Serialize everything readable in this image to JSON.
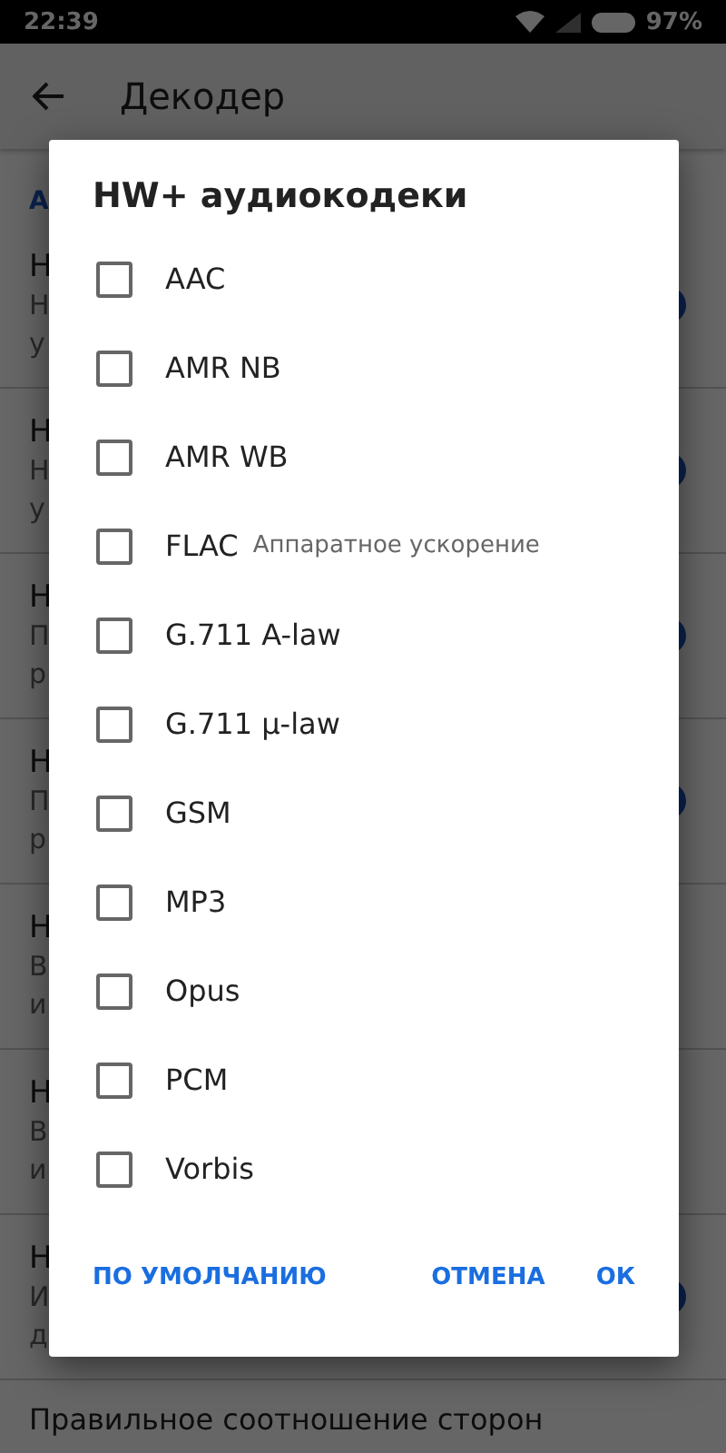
{
  "status_bar": {
    "time": "22:39",
    "battery": "97%"
  },
  "app_bar": {
    "title": "Декодер"
  },
  "section_header": "А",
  "settings_rows": [
    {
      "title": "Н",
      "lines": [
        "Н",
        "у"
      ],
      "on": true
    },
    {
      "title": "Н",
      "lines": [
        "Н",
        "у"
      ],
      "on": true
    },
    {
      "title": "Н",
      "lines": [
        "П",
        "р"
      ],
      "on": true
    },
    {
      "title": "Н",
      "lines": [
        "П",
        "р"
      ],
      "on": true
    },
    {
      "title": "Н",
      "lines": [
        "В",
        "и"
      ],
      "on": false
    },
    {
      "title": "Н",
      "lines": [
        "В",
        "и"
      ],
      "on": false
    },
    {
      "title": "Н",
      "lines": [
        "И",
        "д"
      ],
      "on": true
    }
  ],
  "last_row": "Правильное соотношение сторон",
  "dialog": {
    "title": "HW+ аудиокодеки",
    "items": [
      {
        "label": "AAC",
        "checked": false
      },
      {
        "label": "AMR NB",
        "checked": false
      },
      {
        "label": "AMR WB",
        "checked": false
      },
      {
        "label": "FLAC",
        "note": "Аппаратное ускорение",
        "checked": false
      },
      {
        "label": "G.711 A-law",
        "checked": false
      },
      {
        "label": "G.711 µ-law",
        "checked": false
      },
      {
        "label": "GSM",
        "checked": false
      },
      {
        "label": "MP3",
        "checked": false
      },
      {
        "label": "Opus",
        "checked": false
      },
      {
        "label": "PCM",
        "checked": false
      },
      {
        "label": "Vorbis",
        "checked": false
      }
    ],
    "buttons": [
      "ПО УМОЛЧАНИЮ",
      "ОТМЕНА",
      "ОК"
    ]
  }
}
